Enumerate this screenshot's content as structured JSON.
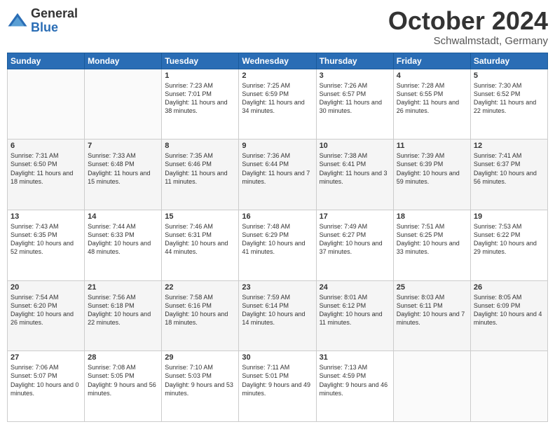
{
  "logo": {
    "general": "General",
    "blue": "Blue"
  },
  "header": {
    "month": "October 2024",
    "location": "Schwalmstadt, Germany"
  },
  "weekdays": [
    "Sunday",
    "Monday",
    "Tuesday",
    "Wednesday",
    "Thursday",
    "Friday",
    "Saturday"
  ],
  "weeks": [
    [
      {
        "day": "",
        "info": ""
      },
      {
        "day": "",
        "info": ""
      },
      {
        "day": "1",
        "info": "Sunrise: 7:23 AM\nSunset: 7:01 PM\nDaylight: 11 hours and 38 minutes."
      },
      {
        "day": "2",
        "info": "Sunrise: 7:25 AM\nSunset: 6:59 PM\nDaylight: 11 hours and 34 minutes."
      },
      {
        "day": "3",
        "info": "Sunrise: 7:26 AM\nSunset: 6:57 PM\nDaylight: 11 hours and 30 minutes."
      },
      {
        "day": "4",
        "info": "Sunrise: 7:28 AM\nSunset: 6:55 PM\nDaylight: 11 hours and 26 minutes."
      },
      {
        "day": "5",
        "info": "Sunrise: 7:30 AM\nSunset: 6:52 PM\nDaylight: 11 hours and 22 minutes."
      }
    ],
    [
      {
        "day": "6",
        "info": "Sunrise: 7:31 AM\nSunset: 6:50 PM\nDaylight: 11 hours and 18 minutes."
      },
      {
        "day": "7",
        "info": "Sunrise: 7:33 AM\nSunset: 6:48 PM\nDaylight: 11 hours and 15 minutes."
      },
      {
        "day": "8",
        "info": "Sunrise: 7:35 AM\nSunset: 6:46 PM\nDaylight: 11 hours and 11 minutes."
      },
      {
        "day": "9",
        "info": "Sunrise: 7:36 AM\nSunset: 6:44 PM\nDaylight: 11 hours and 7 minutes."
      },
      {
        "day": "10",
        "info": "Sunrise: 7:38 AM\nSunset: 6:41 PM\nDaylight: 11 hours and 3 minutes."
      },
      {
        "day": "11",
        "info": "Sunrise: 7:39 AM\nSunset: 6:39 PM\nDaylight: 10 hours and 59 minutes."
      },
      {
        "day": "12",
        "info": "Sunrise: 7:41 AM\nSunset: 6:37 PM\nDaylight: 10 hours and 56 minutes."
      }
    ],
    [
      {
        "day": "13",
        "info": "Sunrise: 7:43 AM\nSunset: 6:35 PM\nDaylight: 10 hours and 52 minutes."
      },
      {
        "day": "14",
        "info": "Sunrise: 7:44 AM\nSunset: 6:33 PM\nDaylight: 10 hours and 48 minutes."
      },
      {
        "day": "15",
        "info": "Sunrise: 7:46 AM\nSunset: 6:31 PM\nDaylight: 10 hours and 44 minutes."
      },
      {
        "day": "16",
        "info": "Sunrise: 7:48 AM\nSunset: 6:29 PM\nDaylight: 10 hours and 41 minutes."
      },
      {
        "day": "17",
        "info": "Sunrise: 7:49 AM\nSunset: 6:27 PM\nDaylight: 10 hours and 37 minutes."
      },
      {
        "day": "18",
        "info": "Sunrise: 7:51 AM\nSunset: 6:25 PM\nDaylight: 10 hours and 33 minutes."
      },
      {
        "day": "19",
        "info": "Sunrise: 7:53 AM\nSunset: 6:22 PM\nDaylight: 10 hours and 29 minutes."
      }
    ],
    [
      {
        "day": "20",
        "info": "Sunrise: 7:54 AM\nSunset: 6:20 PM\nDaylight: 10 hours and 26 minutes."
      },
      {
        "day": "21",
        "info": "Sunrise: 7:56 AM\nSunset: 6:18 PM\nDaylight: 10 hours and 22 minutes."
      },
      {
        "day": "22",
        "info": "Sunrise: 7:58 AM\nSunset: 6:16 PM\nDaylight: 10 hours and 18 minutes."
      },
      {
        "day": "23",
        "info": "Sunrise: 7:59 AM\nSunset: 6:14 PM\nDaylight: 10 hours and 14 minutes."
      },
      {
        "day": "24",
        "info": "Sunrise: 8:01 AM\nSunset: 6:12 PM\nDaylight: 10 hours and 11 minutes."
      },
      {
        "day": "25",
        "info": "Sunrise: 8:03 AM\nSunset: 6:11 PM\nDaylight: 10 hours and 7 minutes."
      },
      {
        "day": "26",
        "info": "Sunrise: 8:05 AM\nSunset: 6:09 PM\nDaylight: 10 hours and 4 minutes."
      }
    ],
    [
      {
        "day": "27",
        "info": "Sunrise: 7:06 AM\nSunset: 5:07 PM\nDaylight: 10 hours and 0 minutes."
      },
      {
        "day": "28",
        "info": "Sunrise: 7:08 AM\nSunset: 5:05 PM\nDaylight: 9 hours and 56 minutes."
      },
      {
        "day": "29",
        "info": "Sunrise: 7:10 AM\nSunset: 5:03 PM\nDaylight: 9 hours and 53 minutes."
      },
      {
        "day": "30",
        "info": "Sunrise: 7:11 AM\nSunset: 5:01 PM\nDaylight: 9 hours and 49 minutes."
      },
      {
        "day": "31",
        "info": "Sunrise: 7:13 AM\nSunset: 4:59 PM\nDaylight: 9 hours and 46 minutes."
      },
      {
        "day": "",
        "info": ""
      },
      {
        "day": "",
        "info": ""
      }
    ]
  ]
}
